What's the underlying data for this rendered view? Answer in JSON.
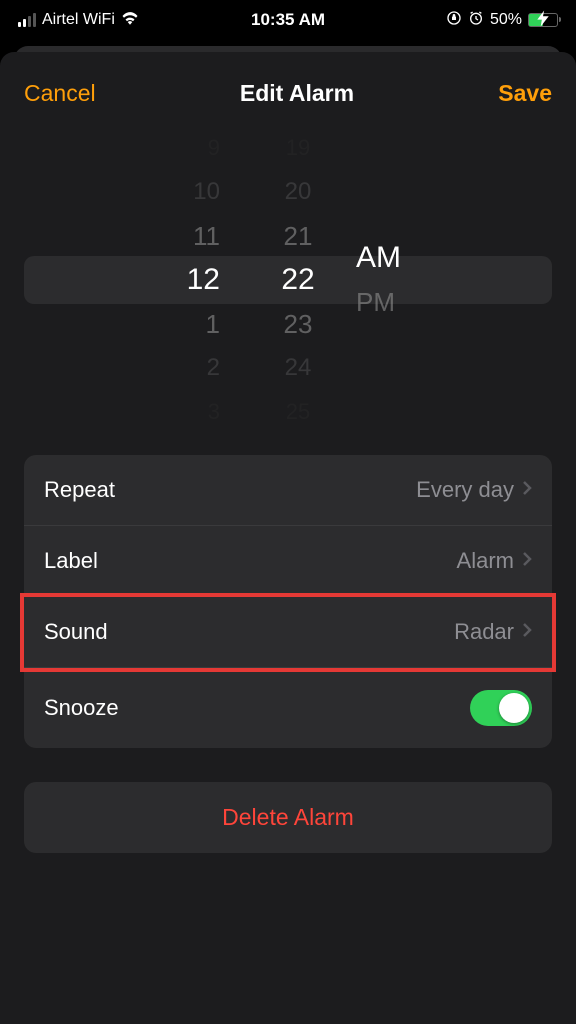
{
  "status": {
    "carrier": "Airtel WiFi",
    "time": "10:35 AM",
    "battery_pct": "50%"
  },
  "nav": {
    "cancel": "Cancel",
    "title": "Edit Alarm",
    "save": "Save"
  },
  "picker": {
    "hours": [
      "9",
      "10",
      "11",
      "12",
      "1",
      "2",
      "3"
    ],
    "minutes": [
      "19",
      "20",
      "21",
      "22",
      "23",
      "24",
      "25"
    ],
    "am": "AM",
    "pm": "PM",
    "selected_hour": "12",
    "selected_minute": "22",
    "selected_ampm": "AM"
  },
  "settings": {
    "repeat": {
      "label": "Repeat",
      "value": "Every day"
    },
    "label": {
      "label": "Label",
      "value": "Alarm"
    },
    "sound": {
      "label": "Sound",
      "value": "Radar"
    },
    "snooze": {
      "label": "Snooze",
      "on": true
    }
  },
  "delete": {
    "label": "Delete Alarm"
  },
  "highlight": "sound"
}
